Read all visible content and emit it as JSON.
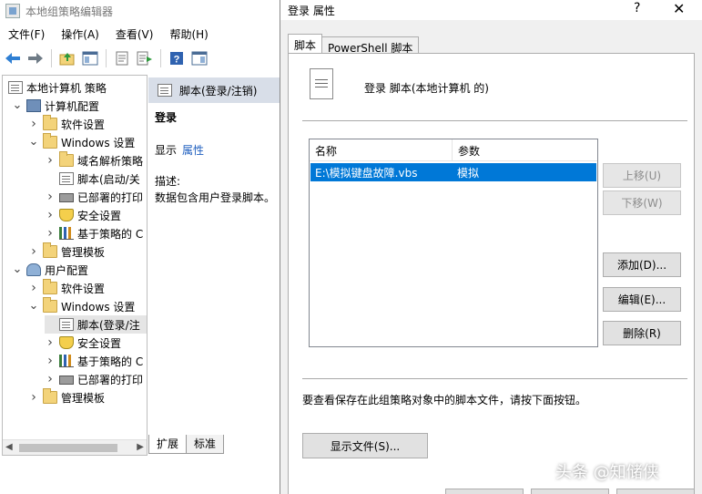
{
  "gpedit": {
    "title": "本地组策略编辑器",
    "menu": [
      "文件(F)",
      "操作(A)",
      "查看(V)",
      "帮助(H)"
    ],
    "tree": [
      {
        "label": "本地计算机 策略",
        "level": 0,
        "chev": "",
        "icon": "script"
      },
      {
        "label": "计算机配置",
        "level": 1,
        "chev": "open",
        "icon": "computer"
      },
      {
        "label": "软件设置",
        "level": 2,
        "chev": "closed",
        "icon": "folder"
      },
      {
        "label": "Windows 设置",
        "level": 2,
        "chev": "open",
        "icon": "folder"
      },
      {
        "label": "域名解析策略",
        "level": 3,
        "chev": "closed",
        "icon": "folder"
      },
      {
        "label": "脚本(启动/关",
        "level": 3,
        "chev": "",
        "icon": "script"
      },
      {
        "label": "已部署的打印",
        "level": 3,
        "chev": "closed",
        "icon": "printer"
      },
      {
        "label": "安全设置",
        "level": 3,
        "chev": "closed",
        "icon": "shield"
      },
      {
        "label": "基于策略的 C",
        "level": 3,
        "chev": "closed",
        "icon": "barchart"
      },
      {
        "label": "管理模板",
        "level": 2,
        "chev": "closed",
        "icon": "folder"
      },
      {
        "label": "用户配置",
        "level": 1,
        "chev": "open",
        "icon": "users"
      },
      {
        "label": "软件设置",
        "level": 2,
        "chev": "closed",
        "icon": "folder"
      },
      {
        "label": "Windows 设置",
        "level": 2,
        "chev": "open",
        "icon": "folder"
      },
      {
        "label": "脚本(登录/注",
        "level": 3,
        "chev": "",
        "icon": "script",
        "selected": true
      },
      {
        "label": "安全设置",
        "level": 3,
        "chev": "closed",
        "icon": "shield"
      },
      {
        "label": "基于策略的 C",
        "level": 3,
        "chev": "closed",
        "icon": "barchart"
      },
      {
        "label": "已部署的打印",
        "level": 3,
        "chev": "closed",
        "icon": "printer"
      },
      {
        "label": "管理模板",
        "level": 2,
        "chev": "closed",
        "icon": "folder"
      }
    ],
    "detail": {
      "header": "脚本(登录/注销)",
      "policy_name": "登录",
      "show_label": "显示",
      "properties_link": "属性",
      "description_label": "描述:",
      "description_text": "数据包含用户登录脚本。",
      "tabs": [
        "扩展",
        "标准"
      ]
    }
  },
  "dialog": {
    "title": "登录 属性",
    "help": "?",
    "close": "✕",
    "tabs": [
      "脚本",
      "PowerShell 脚本"
    ],
    "heading": "登录 脚本(本地计算机 的)",
    "list": {
      "columns": [
        "名称",
        "参数"
      ],
      "rows": [
        {
          "name": "E:\\模拟键盘故障.vbs",
          "params": "模拟",
          "selected": true
        }
      ]
    },
    "buttons": {
      "up": "上移(U)",
      "down": "下移(W)",
      "add": "添加(D)...",
      "edit": "编辑(E)...",
      "remove": "删除(R)",
      "show_files": "显示文件(S)..."
    },
    "hint": "要查看保存在此组策略对象中的脚本文件，请按下面按钮。"
  },
  "watermark": "头条 @知储侠",
  "colors": {
    "selection": "#0078d7",
    "link": "#1f5fbf",
    "detail_header": "#d8dee8"
  }
}
